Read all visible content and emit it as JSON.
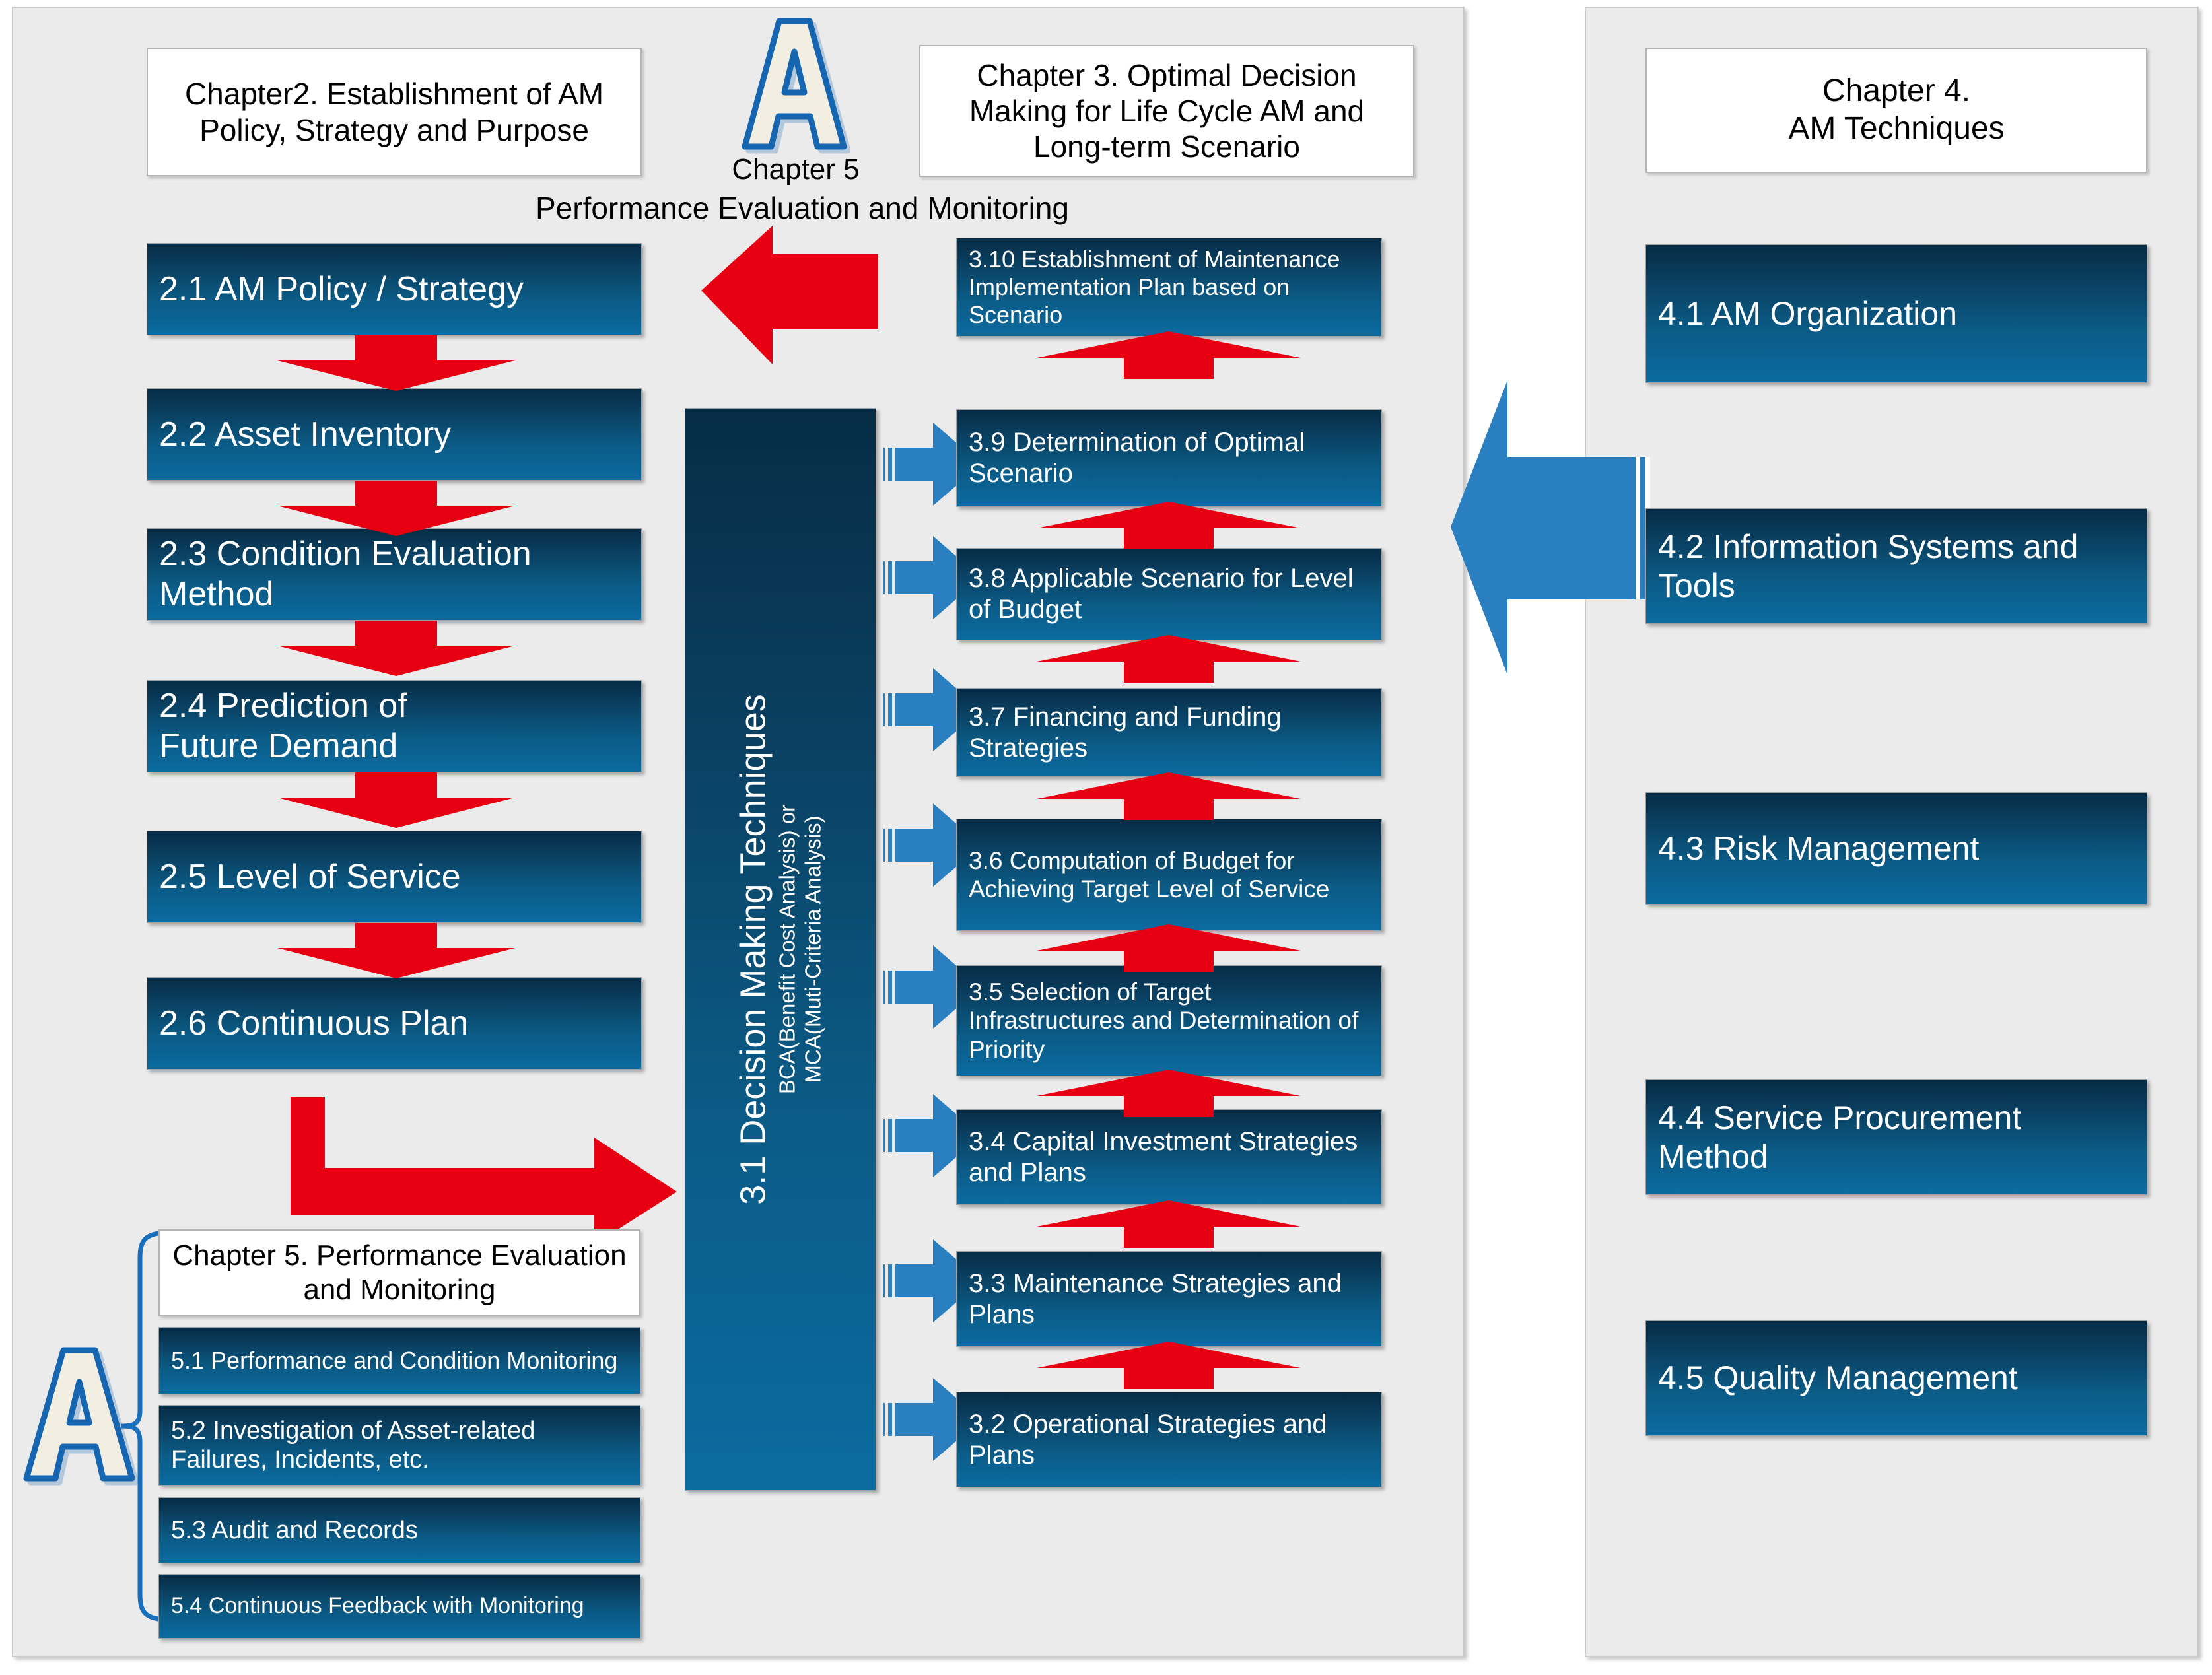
{
  "meta": {
    "colors": {
      "panel_bg": "#ebebeb",
      "box_gradient_top": "#062c45",
      "box_gradient_bottom": "#0b6ba0",
      "red_arrow": "#e60012",
      "blue_arrow": "#2a7fc0",
      "letter_a_fill": "#f2efe2",
      "letter_a_stroke": "#1565b0"
    }
  },
  "chapter2": {
    "header": "Chapter2. Establishment of AM Policy, Strategy and Purpose",
    "items": [
      {
        "id": "2.1",
        "label": "2.1 AM Policy / Strategy"
      },
      {
        "id": "2.2",
        "label": "2.2 Asset Inventory"
      },
      {
        "id": "2.3",
        "label": "2.3 Condition Evaluation Method"
      },
      {
        "id": "2.4",
        "label": "2.4 Prediction of\nFuture Demand"
      },
      {
        "id": "2.5",
        "label": "2.5 Level of Service"
      },
      {
        "id": "2.6",
        "label": "2.6 Continuous Plan"
      }
    ]
  },
  "chapter5_top": {
    "letter": "A",
    "caption": "Chapter 5",
    "subtitle": "Performance Evaluation and Monitoring"
  },
  "chapter3": {
    "header": "Chapter 3. Optimal Decision Making for Life Cycle AM and Long-term Scenario",
    "techniques_box": {
      "main": "3.1 Decision Making Techniques",
      "sub_line1": "BCA(Benefit Cost Analysis) or",
      "sub_line2": "MCA(Muti-Criteria Analysis)"
    },
    "items": [
      {
        "id": "3.10",
        "label": "3.10 Establishment of Maintenance Implementation Plan based on Scenario"
      },
      {
        "id": "3.9",
        "label": "3.9 Determination of Optimal Scenario"
      },
      {
        "id": "3.8",
        "label": "3.8 Applicable Scenario for Level of Budget"
      },
      {
        "id": "3.7",
        "label": "3.7 Financing and Funding Strategies"
      },
      {
        "id": "3.6",
        "label": "3.6 Computation of Budget for Achieving Target Level of Service"
      },
      {
        "id": "3.5",
        "label": "3.5 Selection of Target Infrastructures and Determination of Priority"
      },
      {
        "id": "3.4",
        "label": "3.4 Capital Investment Strategies and Plans"
      },
      {
        "id": "3.3",
        "label": "3.3 Maintenance Strategies and Plans"
      },
      {
        "id": "3.2",
        "label": "3.2 Operational Strategies and Plans"
      }
    ]
  },
  "chapter5_bottom": {
    "letter": "A",
    "header": "Chapter 5. Performance Evaluation and Monitoring",
    "items": [
      {
        "id": "5.1",
        "label": "5.1 Performance and Condition Monitoring"
      },
      {
        "id": "5.2",
        "label": "5.2 Investigation of Asset-related Failures, Incidents, etc."
      },
      {
        "id": "5.3",
        "label": "5.3 Audit and Records"
      },
      {
        "id": "5.4",
        "label": "5.4 Continuous Feedback with Monitoring"
      }
    ]
  },
  "chapter4": {
    "header": "Chapter 4.\nAM Techniques",
    "items": [
      {
        "id": "4.1",
        "label": "4.1 AM Organization"
      },
      {
        "id": "4.2",
        "label": "4.2 Information Systems and Tools"
      },
      {
        "id": "4.3",
        "label": "4.3 Risk Management"
      },
      {
        "id": "4.4",
        "label": "4.4 Service Procurement Method"
      },
      {
        "id": "4.5",
        "label": "4.5 Quality Management"
      }
    ]
  }
}
